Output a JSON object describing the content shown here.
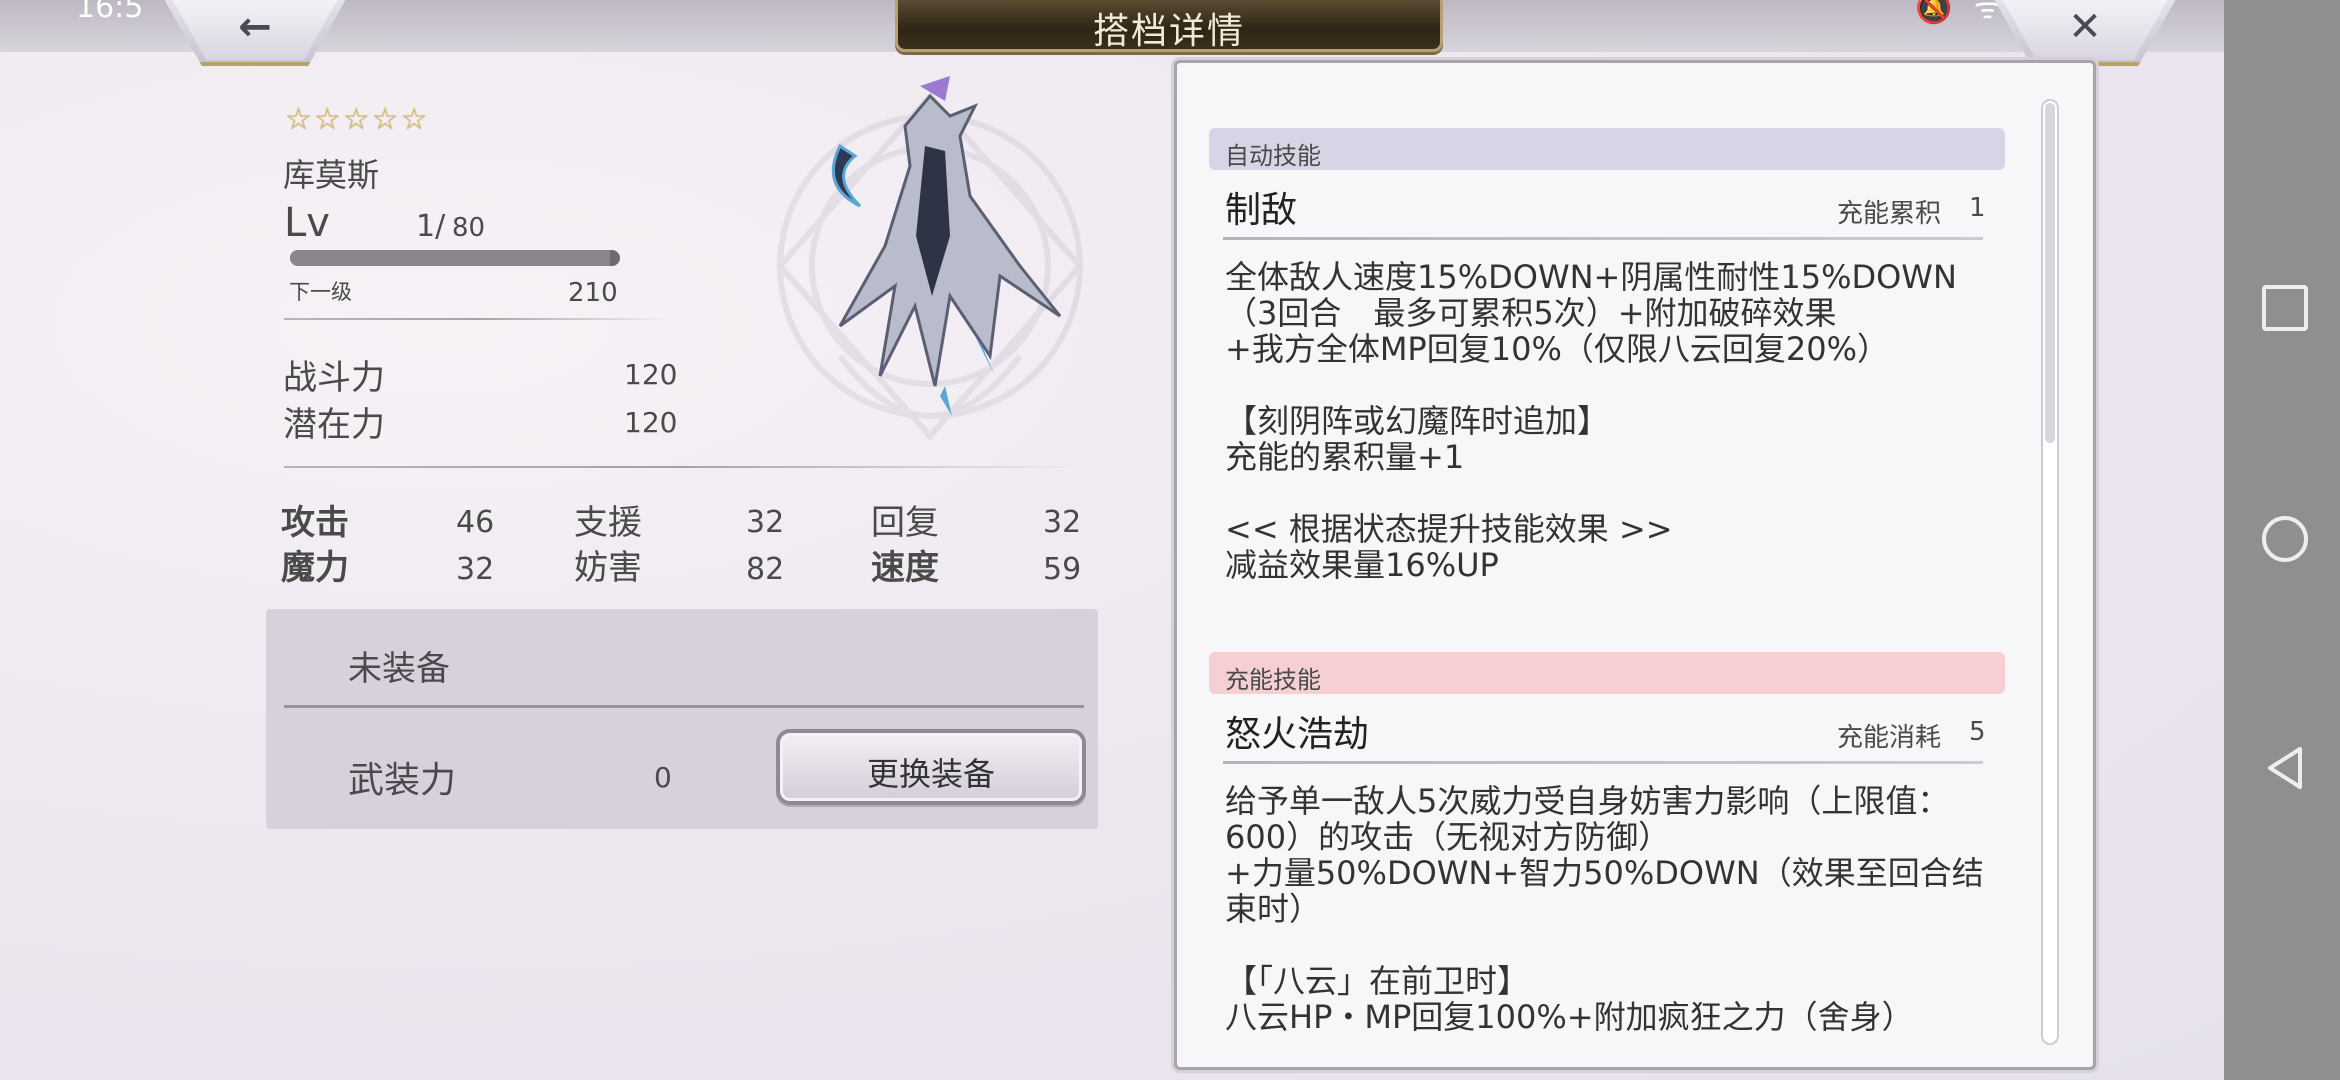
{
  "status_bar": {
    "time": "16:5",
    "icons": "🔕 ᯤ ▮▮"
  },
  "header": {
    "title": "搭档详情",
    "back_glyph": "←",
    "close_glyph": "✕"
  },
  "character": {
    "stars": "☆☆☆☆☆",
    "name": "库莫斯",
    "lv_label": "Lv",
    "level": "1/",
    "max_level": "80",
    "exp_progress": 0.97,
    "next_label": "下一级",
    "next_value": "210",
    "combat_label": "战斗力",
    "combat_value": "120",
    "potential_label": "潜在力",
    "potential_value": "120"
  },
  "stats": [
    {
      "label": "攻击",
      "value": "46",
      "bold": true
    },
    {
      "label": "支援",
      "value": "32",
      "bold": false
    },
    {
      "label": "回复",
      "value": "32",
      "bold": false
    },
    {
      "label": "魔力",
      "value": "32",
      "bold": true
    },
    {
      "label": "妨害",
      "value": "82",
      "bold": false
    },
    {
      "label": "速度",
      "value": "59",
      "bold": true
    }
  ],
  "equipment": {
    "none_label": "未装备",
    "force_label": "武装力",
    "force_value": "0",
    "swap_label": "更换装备"
  },
  "skills": {
    "auto": {
      "tag": "自动技能",
      "name": "制敌",
      "meta_label": "充能累积",
      "meta_value": "1",
      "desc": "全体敌人速度15%DOWN+阴属性耐性15%DOWN\n（3回合　最多可累积5次）+附加破碎效果\n+我方全体MP回复10%（仅限八云回复20%）\n\n【刻阴阵或幻魔阵时追加】\n充能的累积量+1\n\n<< 根据状态提升技能效果 >>\n减益效果量16%UP"
    },
    "charge": {
      "tag": "充能技能",
      "name": "怒火浩劫",
      "meta_label": "充能消耗",
      "meta_value": "5",
      "desc": "给予单一敌人5次威力受自身妨害力影响（上限值：\n600）的攻击（无视对方防御）\n+力量50%DOWN+智力50%DOWN（效果至回合结\n束时）\n\n【「八云」在前卫时】\n八云HP・MP回复100%+附加疯狂之力（舍身）"
    }
  }
}
